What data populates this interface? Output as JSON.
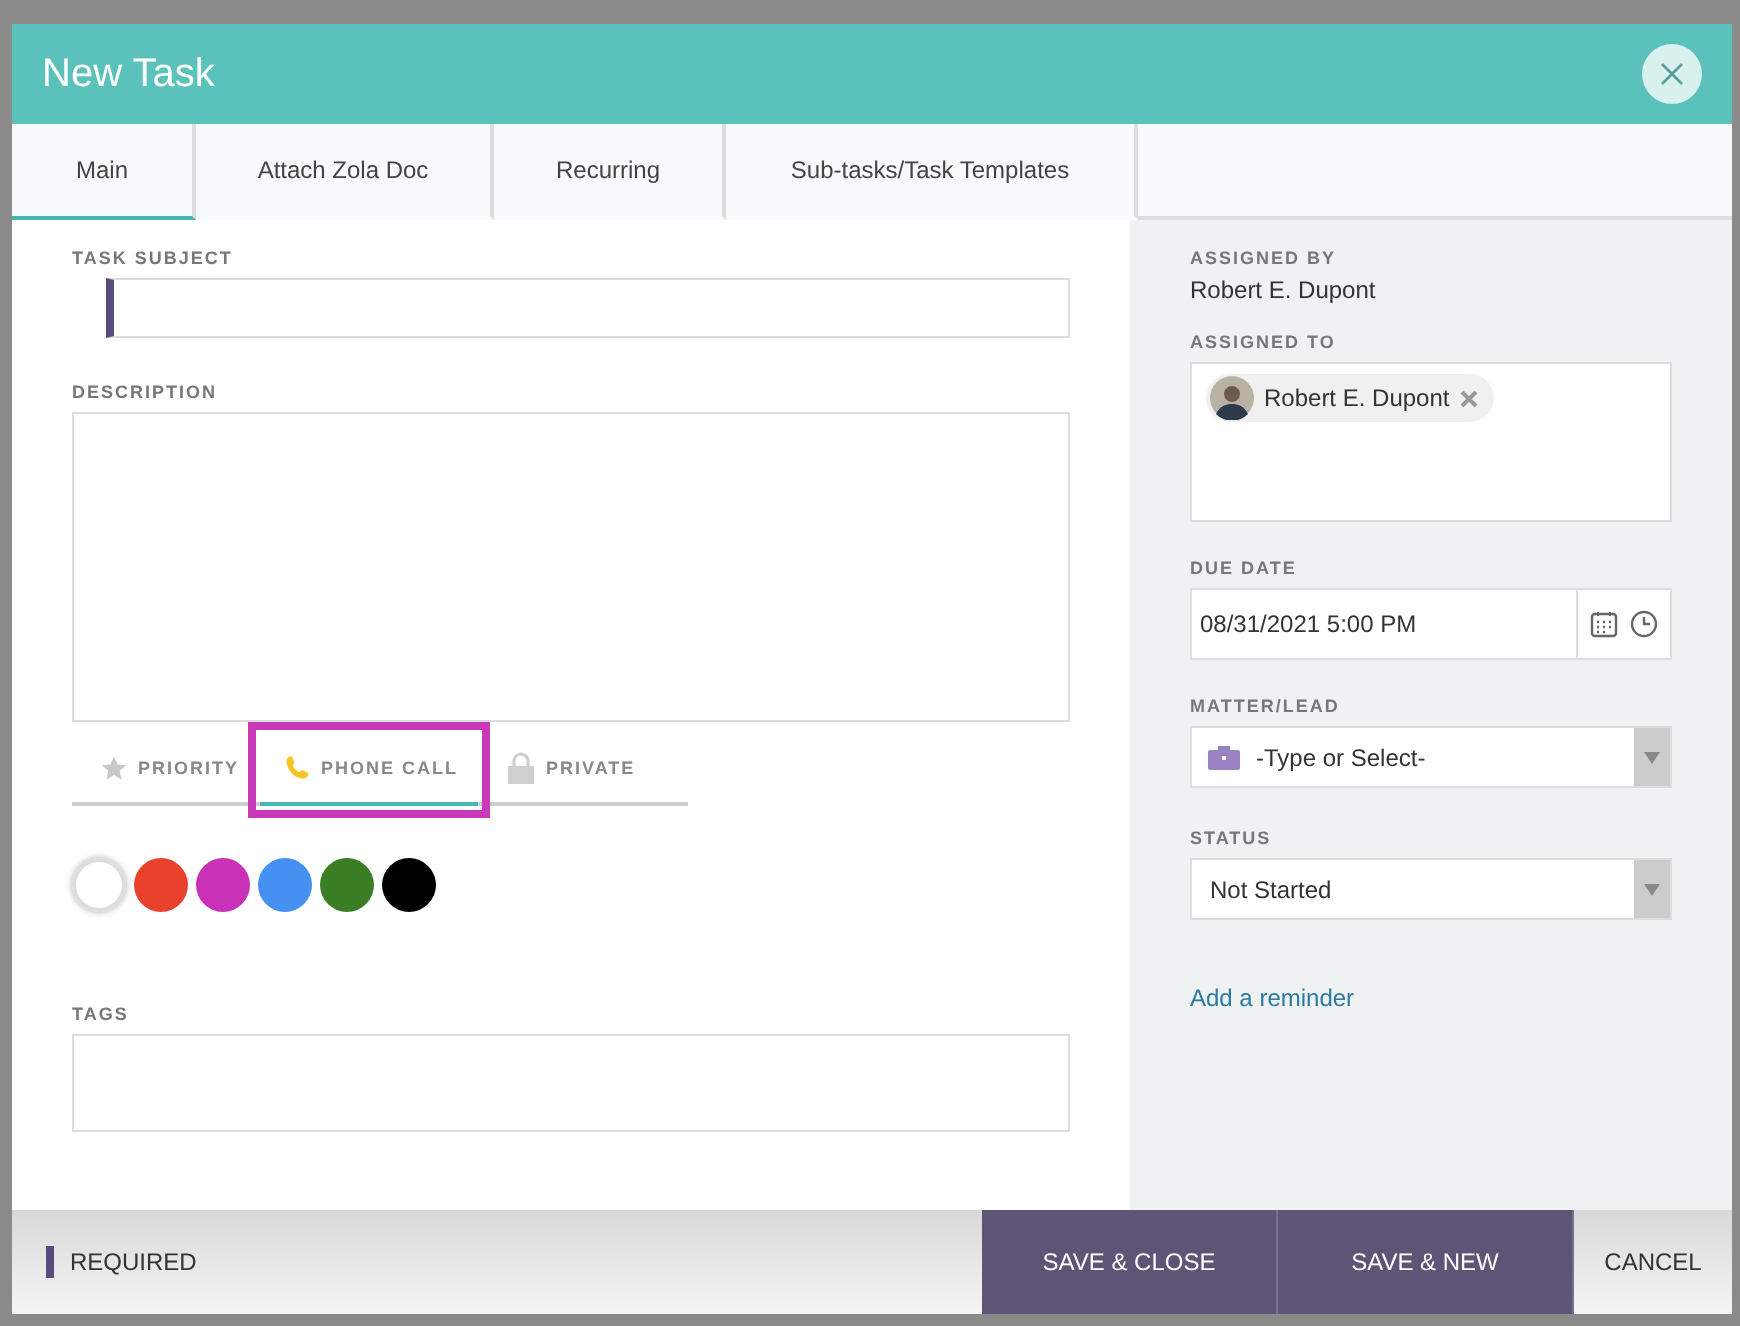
{
  "window": {
    "title": "New Task"
  },
  "tabs": [
    {
      "label": "Main",
      "selected": true
    },
    {
      "label": "Attach Zola Doc",
      "selected": false
    },
    {
      "label": "Recurring",
      "selected": false
    },
    {
      "label": "Sub-tasks/Task Templates",
      "selected": false
    }
  ],
  "main": {
    "task_subject": {
      "label": "TASK SUBJECT",
      "required": true
    },
    "description": {
      "label": "DESCRIPTION"
    },
    "task_types": [
      {
        "label": "PRIORITY",
        "kind": "star",
        "selected": false,
        "highlighted": false
      },
      {
        "label": "PHONE CALL",
        "kind": "phone",
        "selected": true,
        "highlighted": true
      },
      {
        "label": "PRIVATE",
        "kind": "lock",
        "selected": false,
        "highlighted": false
      }
    ],
    "colors": [
      {
        "color": "#ffffff",
        "selected": true
      },
      {
        "color": "#e8412c",
        "selected": false
      },
      {
        "color": "#c931b6",
        "selected": false
      },
      {
        "color": "#4590f0",
        "selected": false
      },
      {
        "color": "#3a7d24",
        "selected": false
      },
      {
        "color": "#000000",
        "selected": false
      }
    ],
    "tags": {
      "label": "TAGS"
    }
  },
  "side": {
    "assigned_by": {
      "label": "ASSIGNED BY",
      "value": "Robert E. Dupont"
    },
    "assigned_to": {
      "label": "ASSIGNED TO",
      "people": [
        "Robert E. Dupont"
      ]
    },
    "due_date": {
      "label": "DUE DATE",
      "value": "08/31/2021 5:00 PM"
    },
    "matter": {
      "label": "MATTER/LEAD",
      "placeholder": "-Type or Select-"
    },
    "status": {
      "label": "STATUS",
      "value": "Not Started"
    },
    "reminder_link": "Add a reminder"
  },
  "footer": {
    "required_legend": "REQUIRED",
    "buttons": [
      {
        "label": "SAVE & CLOSE",
        "kind": "primary"
      },
      {
        "label": "SAVE & NEW",
        "kind": "primary"
      },
      {
        "label": "CANCEL",
        "kind": "plain"
      }
    ]
  }
}
